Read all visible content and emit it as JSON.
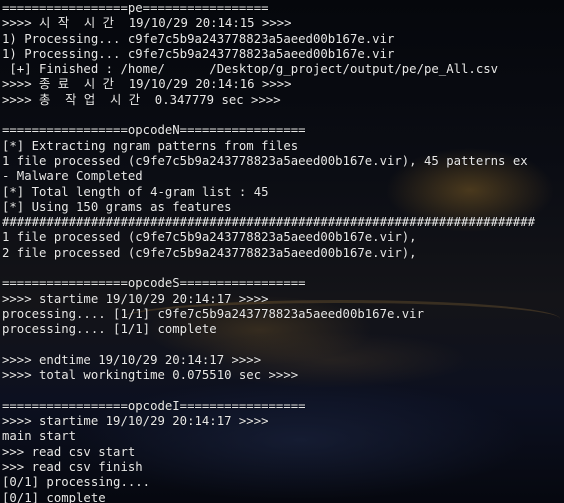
{
  "terminal": {
    "lines": [
      "=================pe=================",
      ">>>> 시 작  시 간  19/10/29 20:14:15 >>>>",
      "1) Processing... c9fe7c5b9a243778823a5aeed00b167e.vir",
      "1) Processing... c9fe7c5b9a243778823a5aeed00b167e.vir",
      " [+] Finished : /home/      /Desktop/g_project/output/pe/pe_All.csv",
      ">>>> 종 료  시 간  19/10/29 20:14:16 >>>>",
      ">>>> 총  작 업  시 간  0.347779 sec >>>>",
      "",
      "=================opcodeN=================",
      "[*] Extracting ngram patterns from files",
      "1 file processed (c9fe7c5b9a243778823a5aeed00b167e.vir), 45 patterns ex",
      "- Malware Completed",
      "[*] Total length of 4-gram list : 45",
      "[*] Using 150 grams as features",
      "########################################################################",
      "1 file processed (c9fe7c5b9a243778823a5aeed00b167e.vir),",
      "2 file processed (c9fe7c5b9a243778823a5aeed00b167e.vir),",
      "",
      "=================opcodeS=================",
      ">>>> startime 19/10/29 20:14:17 >>>>",
      "processing.... [1/1] c9fe7c5b9a243778823a5aeed00b167e.vir",
      "processing.... [1/1] complete",
      "",
      ">>>> endtime 19/10/29 20:14:17 >>>>",
      ">>>> total workingtime 0.075510 sec >>>>",
      "",
      "=================opcodeI=================",
      ">>>> startime 19/10/29 20:14:17 >>>>",
      "main start",
      ">>> read csv start",
      ">>> read csv finish",
      "[0/1] processing....",
      "[0/1] complete"
    ]
  }
}
